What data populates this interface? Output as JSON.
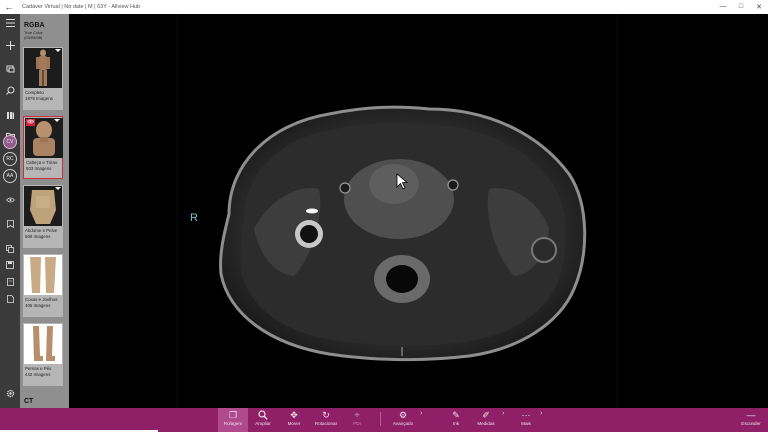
{
  "window": {
    "title": "Cadáver Virtual | No date | M | 63Y - Allview Hub",
    "back_glyph": "←",
    "minimize_glyph": "—",
    "maximize_glyph": "□",
    "close_glyph": "✕"
  },
  "rail": {
    "circles": [
      "CV",
      "RC",
      "AA"
    ]
  },
  "panel": {
    "title": "RGBA",
    "subtitle_line1": "True Color",
    "subtitle_line2": "(03/05/08)",
    "series": [
      {
        "name": "Completo",
        "count": "1879 Imagens"
      },
      {
        "name": "Cabeça e Tórax",
        "count": "503 Imagens"
      },
      {
        "name": "Abdome e Pelve",
        "count": "508 Imagens"
      },
      {
        "name": "Coxas e Joelhos",
        "count": "406 Imagens"
      },
      {
        "name": "Pernas e Pés",
        "count": "442 Imagens"
      }
    ],
    "modality": "CT"
  },
  "viewer": {
    "orientation_label": "R"
  },
  "toolbar": {
    "tools": [
      {
        "label": "Rolagem",
        "icon": "stack-icon",
        "glyph": "❐"
      },
      {
        "label": "Ampliar",
        "icon": "zoom-icon",
        "glyph": "🔍"
      },
      {
        "label": "Mover",
        "icon": "move-icon",
        "glyph": "✥"
      },
      {
        "label": "Rotacionar",
        "icon": "rotate-icon",
        "glyph": "↻"
      },
      {
        "label": "PDI",
        "icon": "pin-icon",
        "glyph": "⌖"
      },
      {
        "label": "Avançado",
        "icon": "gear-icon",
        "glyph": "⚙"
      },
      {
        "label": "Ink",
        "icon": "pen-icon",
        "glyph": "✎"
      },
      {
        "label": "Medidas",
        "icon": "ruler-icon",
        "glyph": "✐"
      },
      {
        "label": "Mais",
        "icon": "more-icon",
        "glyph": "⋯"
      },
      {
        "label": "Esconder",
        "icon": "hide-icon",
        "glyph": "—"
      }
    ],
    "chevron_glyph": "›"
  },
  "colors": {
    "toolbar": "#8f1f66",
    "panel": "#8f8f8f",
    "rail": "#3a3a3a",
    "selection": "#ce2b3e",
    "orientation": "#6ec7d9"
  }
}
